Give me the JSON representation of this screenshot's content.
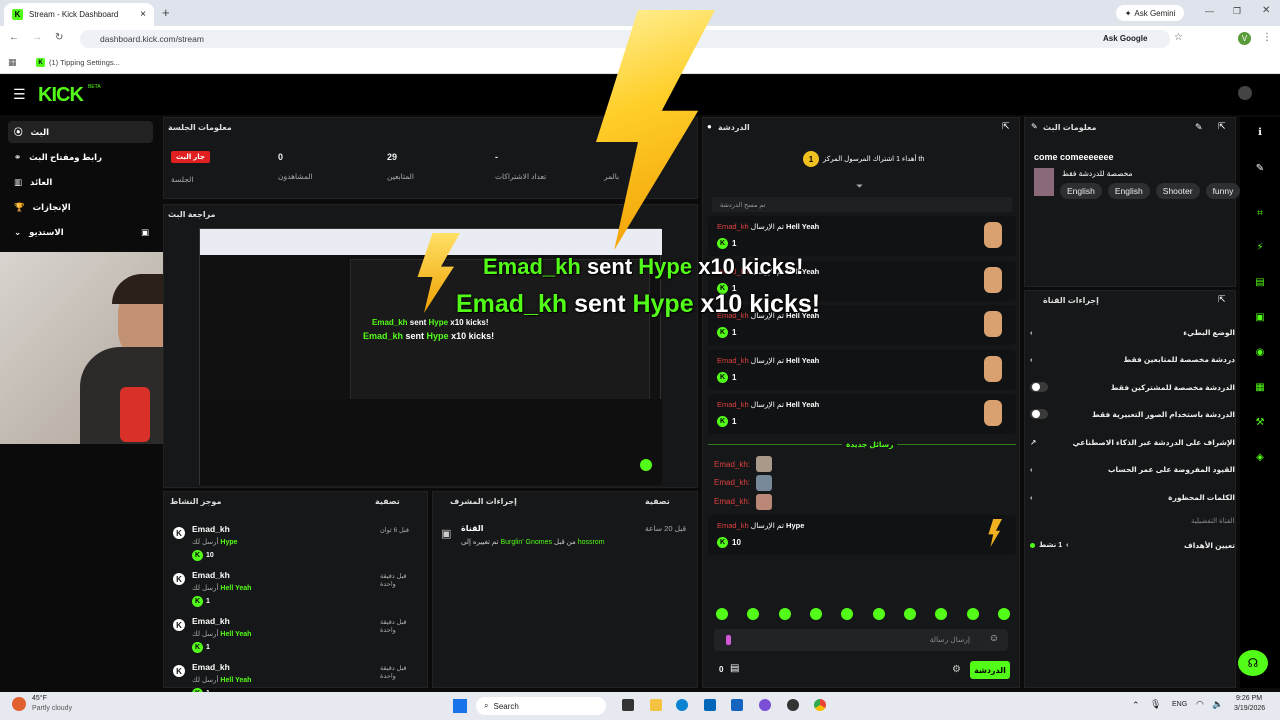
{
  "browser": {
    "tab_title": "Stream - Kick Dashboard",
    "ask_gemini": "Ask Gemini",
    "url": "dashboard.kick.com/stream",
    "ask_google": "Ask Google",
    "bookmark": "(1) Tipping Settings...",
    "profile_initial": "V"
  },
  "header": {
    "logo": "KICK",
    "beta": "BETA"
  },
  "sidebar": {
    "items": [
      {
        "label": "البث"
      },
      {
        "label": "رابط ومفتاح البث"
      },
      {
        "label": "العائد"
      },
      {
        "label": "الإنجازات"
      },
      {
        "label": "الاستديو"
      }
    ]
  },
  "session": {
    "title": "معلومات الجلسة",
    "live_badge": "جار البث",
    "session_label": "الجلسة",
    "viewers_value": "0",
    "viewers_label": "المشاهدون",
    "followers_value": "29",
    "followers_label": "المتابعين",
    "subs_value": "-",
    "subs_label": "تعداد الاشتراكات",
    "extra_label": "بالمر"
  },
  "preview": {
    "title": "مراجعة البث"
  },
  "alert": {
    "user": "Emad_kh",
    "text": " sent ",
    "item": "Hype",
    "mult": " x10 kicks!"
  },
  "activity": {
    "title": "موجز النشاط",
    "filter": "تصفية",
    "items": [
      {
        "user": "Emad_kh",
        "action": "أرسل لك",
        "item": "Hype",
        "time": "قبل 6 ثوان",
        "amount": "10"
      },
      {
        "user": "Emad_kh",
        "action": "أرسل لك",
        "item": "Hell Yeah",
        "time": "قبل دقيقة واحدة",
        "amount": "1"
      },
      {
        "user": "Emad_kh",
        "action": "أرسل لك",
        "item": "Hell Yeah",
        "time": "قبل دقيقة واحدة",
        "amount": "1"
      },
      {
        "user": "Emad_kh",
        "action": "أرسل لك",
        "item": "Hell Yeah",
        "time": "قبل دقيقة واحدة",
        "amount": "1"
      }
    ]
  },
  "mod": {
    "title": "إجراءات المشرف",
    "filter": "تصفية",
    "label": "القناة",
    "text": "تم تغييره إلى",
    "game": "Burglin' Gnomes",
    "by": "من قبل",
    "user": "hossrom",
    "time": "قبل 20 ساعة"
  },
  "chat": {
    "title": "الدردشة",
    "pinned": "أهداء 1 اشتراك المرسول المركز th",
    "cleared": "تم مسح الدردشة",
    "messages": [
      {
        "user": "Emad_kh",
        "text": "تم الإرسال",
        "item": "Hell Yeah",
        "amount": "1"
      },
      {
        "user": "Emad_kh",
        "text": "تم الإرسال",
        "item": "Hell Yeah",
        "amount": "1"
      },
      {
        "user": "Emad_kh",
        "text": "تم الإرسال",
        "item": "Hell Yeah",
        "amount": "1"
      },
      {
        "user": "Emad_kh",
        "text": "تم الإرسال",
        "item": "Hell Yeah",
        "amount": "1"
      },
      {
        "user": "Emad_kh",
        "text": "تم الإرسال",
        "item": "Hell Yeah",
        "amount": "1"
      }
    ],
    "new_messages": "رسائل جديدة",
    "users": [
      "Emad_kh:",
      "Emad_kh:",
      "Emad_kh:"
    ],
    "hype": {
      "user": "Emad_kh",
      "text": "تم الإرسال",
      "item": "Hype",
      "amount": "10"
    },
    "placeholder": "إرسال رسالة",
    "count": "0",
    "send": "الدردشة"
  },
  "stream_info": {
    "title": "معلومات البث",
    "stream_title": "come comeeeeeee",
    "category": "مخصصة للدردشة فقط",
    "tags": [
      "English",
      "English",
      "Shooter",
      "funny"
    ]
  },
  "channel_actions": {
    "title": "إجراءات القناة",
    "items": [
      {
        "label": "الوضع البطيء"
      },
      {
        "label": "دردشة مخصصة للمتابعين فقط"
      },
      {
        "label": "الدردشة مخصصة للمشتركين فقط"
      },
      {
        "label": "الدردشة باستخدام الصور التعبيرية فقط"
      },
      {
        "label": "الإشراف على الدردشة عبر الذكاء الاصطناعي"
      },
      {
        "label": "القيود المفروضة على عمر الحساب"
      },
      {
        "label": "الكلمات المحظورة"
      }
    ],
    "section": "القناة التفضيلية",
    "goals": "تعيين الأهداف",
    "goals_value": "1 نشط"
  },
  "taskbar": {
    "temp": "45°F",
    "weather": "Partly cloudy",
    "search": "Search",
    "lang": "ENG",
    "time": "9:26 PM",
    "date": "3/19/2026"
  }
}
